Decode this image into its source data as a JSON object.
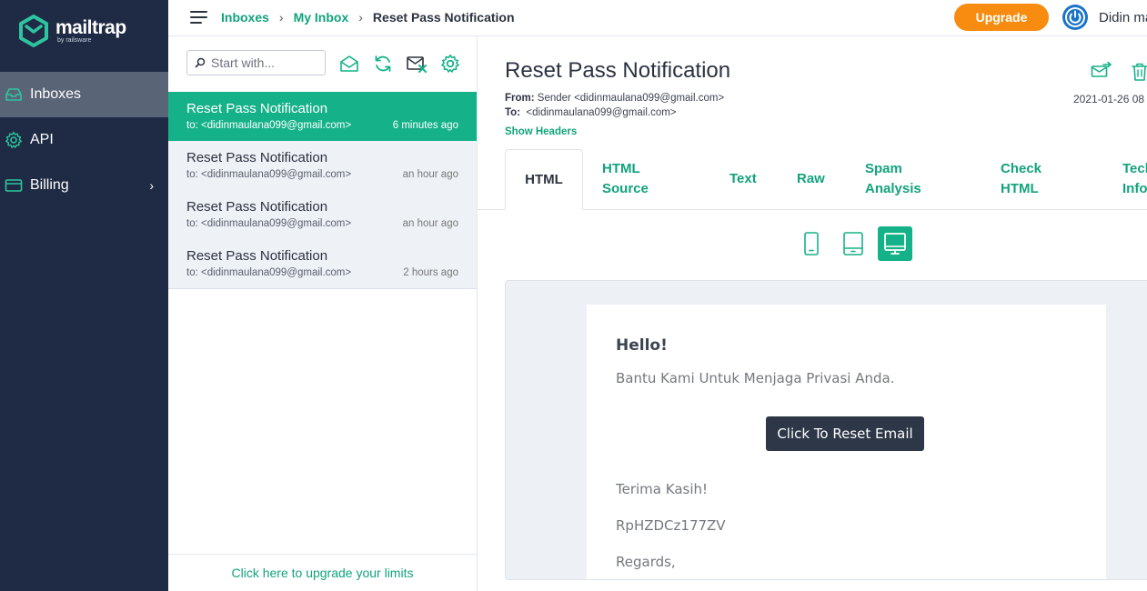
{
  "brand": {
    "name": "mailtrap",
    "sub": "by railsware",
    "accent": "#15b289"
  },
  "sidebar": {
    "items": [
      {
        "label": "Inboxes",
        "icon": "inbox-icon",
        "active": true
      },
      {
        "label": "API",
        "icon": "gear-icon",
        "active": false
      },
      {
        "label": "Billing",
        "icon": "credit-card-icon",
        "active": false,
        "chevron": "›"
      }
    ]
  },
  "topbar": {
    "breadcrumbs": [
      "Inboxes",
      "My Inbox",
      "Reset Pass Notification"
    ],
    "separator": "›",
    "upgrade_label": "Upgrade",
    "user_name": "Didin ma"
  },
  "list": {
    "search_placeholder": "Start with...",
    "tools": [
      "mark-read-icon",
      "refresh-icon",
      "clear-inbox-icon",
      "settings-icon"
    ],
    "messages": [
      {
        "subject": "Reset Pass Notification",
        "to": "to: <didinmaulana099@gmail.com>",
        "time": "6 minutes ago",
        "active": true
      },
      {
        "subject": "Reset Pass Notification",
        "to": "to: <didinmaulana099@gmail.com>",
        "time": "an hour ago",
        "active": false
      },
      {
        "subject": "Reset Pass Notification",
        "to": "to: <didinmaulana099@gmail.com>",
        "time": "an hour ago",
        "active": false
      },
      {
        "subject": "Reset Pass Notification",
        "to": "to: <didinmaulana099@gmail.com>",
        "time": "2 hours ago",
        "active": false
      }
    ],
    "upgrade_link": "Click here to upgrade your limits"
  },
  "message": {
    "title": "Reset Pass Notification",
    "from_label": "From:",
    "from_value": "Sender <didinmaulana099@gmail.com>",
    "to_label": "To:",
    "to_value": "<didinmaulana099@gmail.com>",
    "date": "2021-01-26 08",
    "show_headers": "Show Headers",
    "tabs": [
      "HTML",
      "HTML Source",
      "Text",
      "Raw",
      "Spam Analysis",
      "Check HTML",
      "Tech Info"
    ],
    "active_tab": "HTML",
    "devices": [
      "phone-icon",
      "tablet-icon",
      "desktop-icon"
    ],
    "active_device": "desktop-icon"
  },
  "email": {
    "greeting": "Hello!",
    "intro": "Bantu Kami Untuk Menjaga Privasi Anda.",
    "button": "Click To Reset Email",
    "thanks": "Terima Kasih!",
    "code": "RpHZDCz177ZV",
    "regards": "Regards,"
  }
}
